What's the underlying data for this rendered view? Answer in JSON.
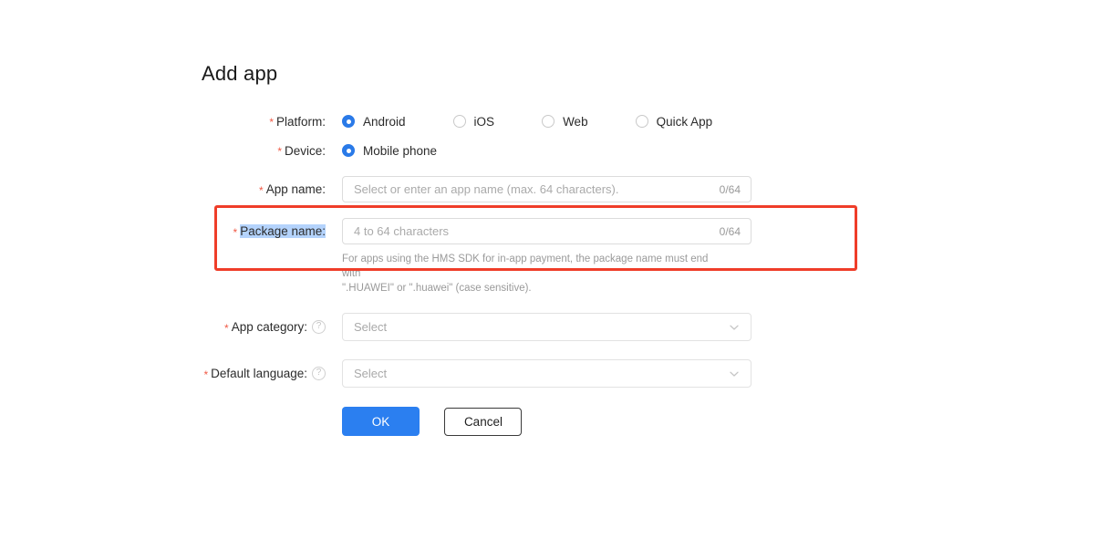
{
  "page": {
    "title": "Add app"
  },
  "form": {
    "platform": {
      "label": "Platform:",
      "required": true,
      "options": [
        {
          "label": "Android",
          "checked": true
        },
        {
          "label": "iOS",
          "checked": false
        },
        {
          "label": "Web",
          "checked": false
        },
        {
          "label": "Quick App",
          "checked": false
        }
      ]
    },
    "device": {
      "label": "Device:",
      "required": true,
      "options": [
        {
          "label": "Mobile phone",
          "checked": true
        }
      ]
    },
    "app_name": {
      "label": "App name:",
      "required": true,
      "value": "",
      "placeholder": "Select or enter an app name (max. 64 characters).",
      "counter": "0/64"
    },
    "package_name": {
      "label": "Package name:",
      "required": true,
      "value": "",
      "placeholder": "4 to 64 characters",
      "counter": "0/64",
      "label_selected": true,
      "helper_line1": "For apps using the HMS SDK for in-app payment, the package name must end with",
      "helper_line2": "\".HUAWEI\" or \".huawei\" (case sensitive)."
    },
    "app_category": {
      "label": "App category:",
      "required": true,
      "help_icon": "question-mark-icon",
      "value": "",
      "placeholder": "Select",
      "chevron": "chevron-down-icon"
    },
    "default_language": {
      "label": "Default language:",
      "required": true,
      "help_icon": "question-mark-icon",
      "value": "",
      "placeholder": "Select",
      "chevron": "chevron-down-icon"
    }
  },
  "actions": {
    "ok_label": "OK",
    "cancel_label": "Cancel"
  },
  "annotation": {
    "highlight_target": "package-name-field",
    "highlight_color": "#ef3d29"
  },
  "colors": {
    "accent_blue": "#2b7ff0",
    "required_star": "#f05a46",
    "selection_highlight": "#b4d3fc",
    "highlight_border": "#ef3d29"
  }
}
